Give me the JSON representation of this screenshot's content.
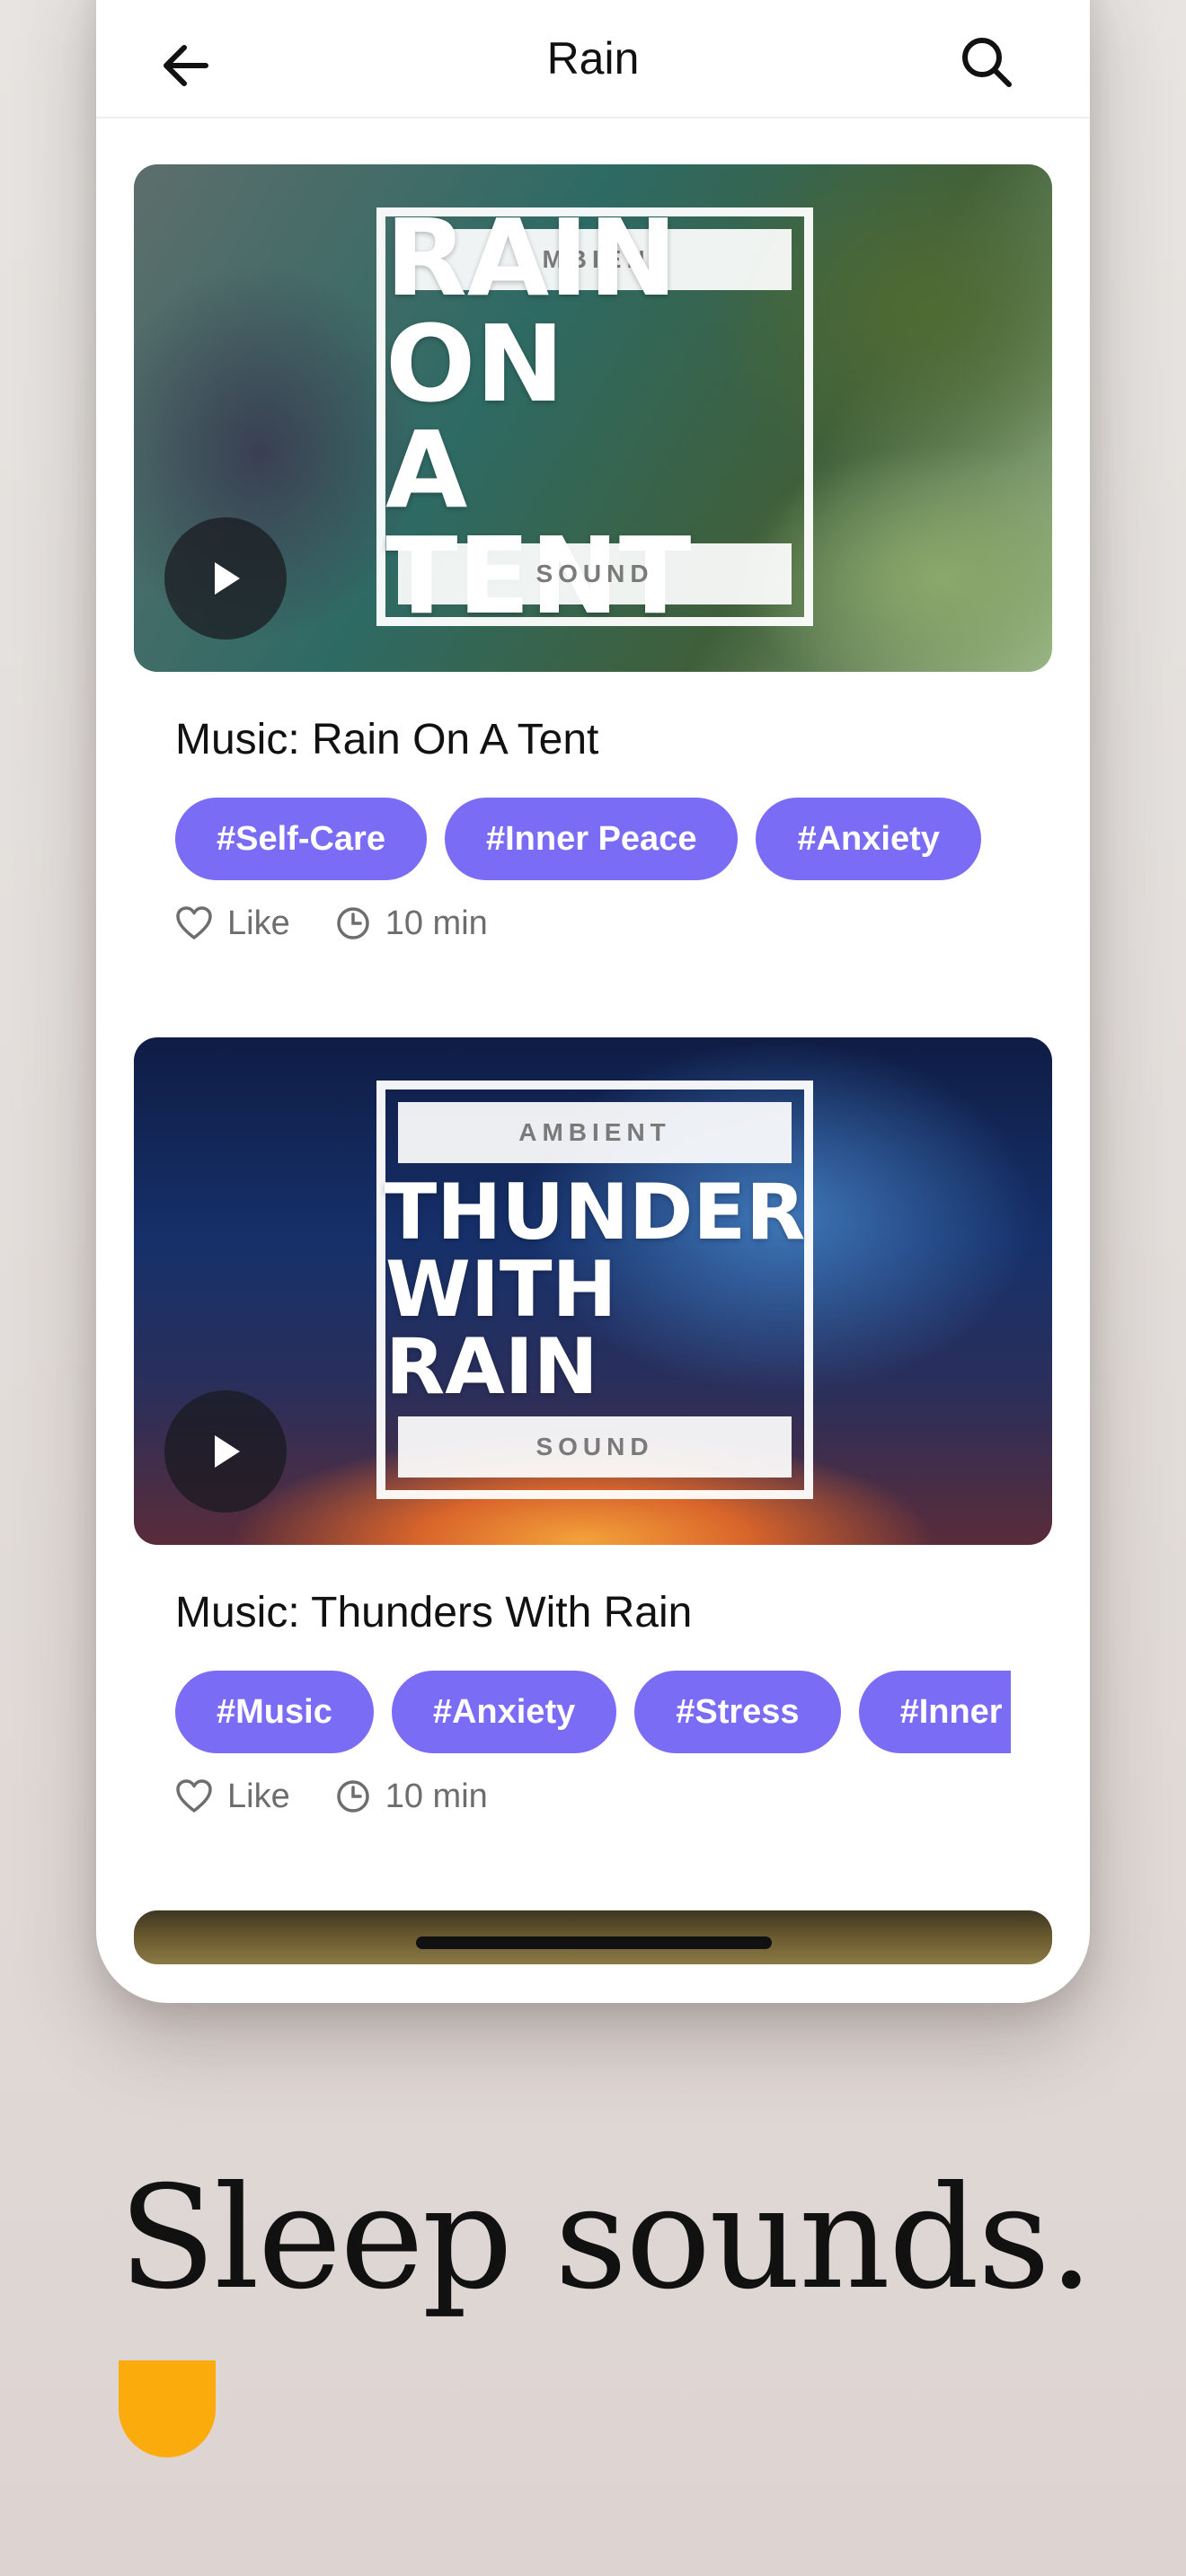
{
  "header": {
    "title": "Rain"
  },
  "cards": [
    {
      "cover": {
        "top_band": "AMBIENT",
        "lines": [
          "RAIN ON",
          "A TENT"
        ],
        "bottom_band": "SOUND"
      },
      "title": "Music: Rain On A Tent",
      "tags": [
        "#Self-Care",
        "#Inner Peace",
        "#Anxiety"
      ],
      "like_label": "Like",
      "duration": "10 min"
    },
    {
      "cover": {
        "top_band": "AMBIENT",
        "lines": [
          "THUNDER",
          "WITH RAIN"
        ],
        "bottom_band": "SOUND"
      },
      "title": "Music: Thunders With Rain",
      "tags": [
        "#Music",
        "#Anxiety",
        "#Stress",
        "#Inner Peace"
      ],
      "like_label": "Like",
      "duration": "10 min"
    }
  ],
  "tagline": "Sleep sounds.",
  "colors": {
    "tag_bg": "#7b6cf6",
    "accent_logo": "#fbab0c",
    "text": "#111111",
    "meta": "#6d6d6d"
  },
  "icons": [
    "back-arrow-icon",
    "search-icon",
    "play-icon",
    "heart-icon",
    "clock-icon",
    "logo-mark-icon"
  ]
}
